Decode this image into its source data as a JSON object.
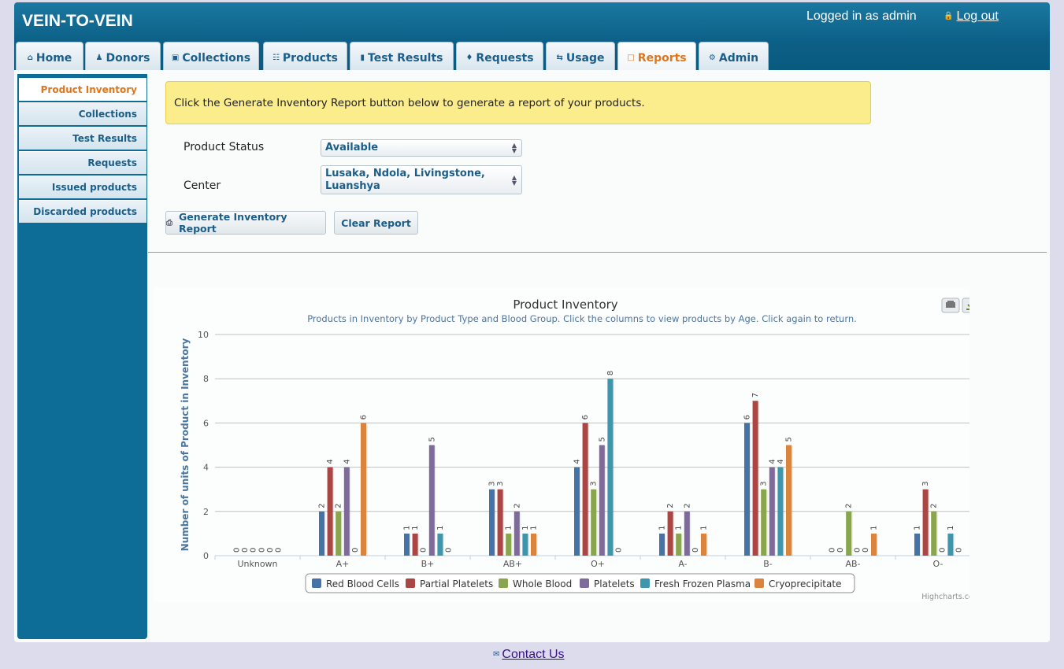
{
  "app": {
    "brand": "VEIN-TO-VEIN",
    "login_text": "Logged in as admin",
    "logout_label": "Log out"
  },
  "tabs": [
    {
      "label": "Home",
      "icon": "home-icon"
    },
    {
      "label": "Donors",
      "icon": "user-icon"
    },
    {
      "label": "Collections",
      "icon": "box-icon"
    },
    {
      "label": "Products",
      "icon": "cart-icon"
    },
    {
      "label": "Test Results",
      "icon": "chart-icon"
    },
    {
      "label": "Requests",
      "icon": "tag-icon"
    },
    {
      "label": "Usage",
      "icon": "swap-icon"
    },
    {
      "label": "Reports",
      "icon": "clipboard-icon",
      "active": true
    },
    {
      "label": "Admin",
      "icon": "gear-icon"
    }
  ],
  "sidebar": {
    "items": [
      {
        "label": "Product Inventory",
        "active": true
      },
      {
        "label": "Collections"
      },
      {
        "label": "Test Results"
      },
      {
        "label": "Requests"
      },
      {
        "label": "Issued products"
      },
      {
        "label": "Discarded products"
      }
    ]
  },
  "notice": "Click the Generate Inventory Report button below to generate a report of your products.",
  "form": {
    "status_label": "Product Status",
    "status_value": "Available",
    "center_label": "Center",
    "center_value": "Lusaka, Ndola, Livingstone, Luanshya",
    "generate_label": "Generate Inventory Report",
    "clear_label": "Clear Report"
  },
  "footer": {
    "contact_label": "Contact Us"
  },
  "colors": {
    "header": "#0c5f86",
    "accent": "#e0761c",
    "link": "#1b5e8a"
  },
  "chart_data": {
    "type": "bar",
    "title": "Product Inventory",
    "subtitle": "Products in Inventory by Product Type and Blood Group. Click the columns to view products by Age. Click again to return.",
    "ylabel": "Number of units of Product in Inventory",
    "xlabel": "",
    "ylim": [
      0,
      10
    ],
    "yticks": [
      0,
      2,
      4,
      6,
      8,
      10
    ],
    "grid": true,
    "legend": "bottom-center",
    "credits": "Highcharts.com",
    "categories": [
      "Unknown",
      "A+",
      "B+",
      "AB+",
      "O+",
      "A-",
      "B-",
      "AB-",
      "O-"
    ],
    "series": [
      {
        "name": "Red Blood Cells",
        "color": "#4572a7",
        "values": [
          0,
          2,
          1,
          3,
          4,
          1,
          6,
          0,
          1
        ]
      },
      {
        "name": "Partial Platelets",
        "color": "#aa4643",
        "values": [
          0,
          4,
          1,
          3,
          6,
          2,
          7,
          0,
          3
        ]
      },
      {
        "name": "Whole Blood",
        "color": "#89a54e",
        "values": [
          0,
          2,
          0,
          1,
          3,
          1,
          3,
          2,
          2
        ]
      },
      {
        "name": "Platelets",
        "color": "#80699b",
        "values": [
          0,
          4,
          5,
          2,
          5,
          2,
          4,
          0,
          0
        ]
      },
      {
        "name": "Fresh Frozen Plasma",
        "color": "#3d96ae",
        "values": [
          0,
          0,
          1,
          1,
          8,
          0,
          4,
          0,
          1
        ]
      },
      {
        "name": "Cryoprecipitate",
        "color": "#db843d",
        "values": [
          0,
          6,
          0,
          1,
          0,
          1,
          5,
          1,
          0
        ]
      }
    ]
  }
}
